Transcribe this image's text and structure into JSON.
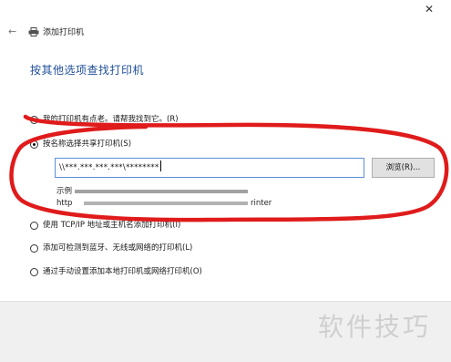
{
  "window": {
    "title": "添加打印机",
    "back_glyph": "←",
    "close_glyph": "✕",
    "back_icon": "back-arrow-icon",
    "title_icon": "printer-icon",
    "close_icon": "close-icon"
  },
  "heading": "按其他选项查找打印机",
  "options": [
    {
      "label": "我的打印机有点老。请帮我找到它。(R)",
      "checked": false
    },
    {
      "label": "按名称选择共享打印机(S)",
      "checked": true
    },
    {
      "label": "使用 TCP/IP 地址或主机名添加打印机(I)",
      "checked": false
    },
    {
      "label": "添加可检测到蓝牙、无线或网络的打印机(L)",
      "checked": false
    },
    {
      "label": "通过手动设置添加本地打印机或网络打印机(O)",
      "checked": false
    }
  ],
  "shared_printer": {
    "path_value": "\\\\***.***.***.***\\********",
    "browse_label": "浏览(R)...",
    "example_prefix": "示例",
    "example_http": "http",
    "example_suffix": "rinter"
  },
  "annotation_color": "#e01b1b",
  "accent_color": "#1f4e9a",
  "watermark": "软件技巧"
}
